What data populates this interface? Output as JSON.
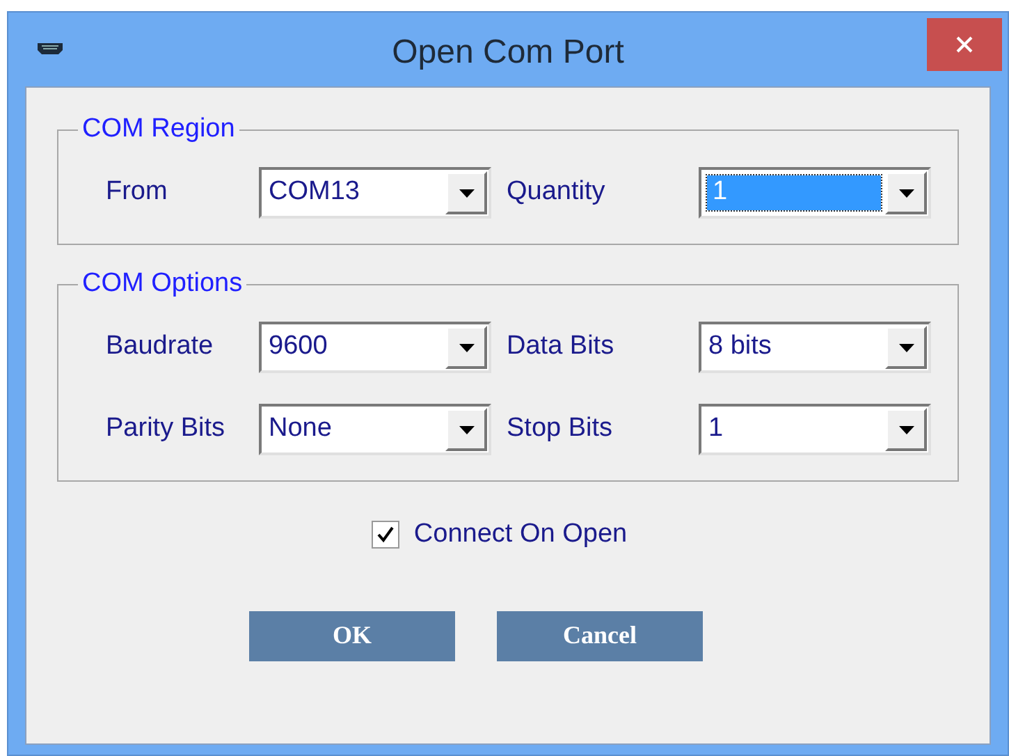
{
  "window": {
    "title": "Open Com Port"
  },
  "groups": [
    {
      "title": "COM Region",
      "fields": [
        {
          "label": "From",
          "value": "COM13",
          "focused": false
        },
        {
          "label": "Quantity",
          "value": "1",
          "focused": true
        }
      ]
    },
    {
      "title": "COM Options",
      "fields": [
        {
          "label": "Baudrate",
          "value": "9600",
          "focused": false
        },
        {
          "label": "Data Bits",
          "value": "8 bits",
          "focused": false
        },
        {
          "label": "Parity Bits",
          "value": "None",
          "focused": false
        },
        {
          "label": "Stop Bits",
          "value": "1",
          "focused": false
        }
      ]
    }
  ],
  "checkbox": {
    "label": "Connect On Open",
    "checked": true
  },
  "buttons": [
    "OK",
    "Cancel"
  ]
}
